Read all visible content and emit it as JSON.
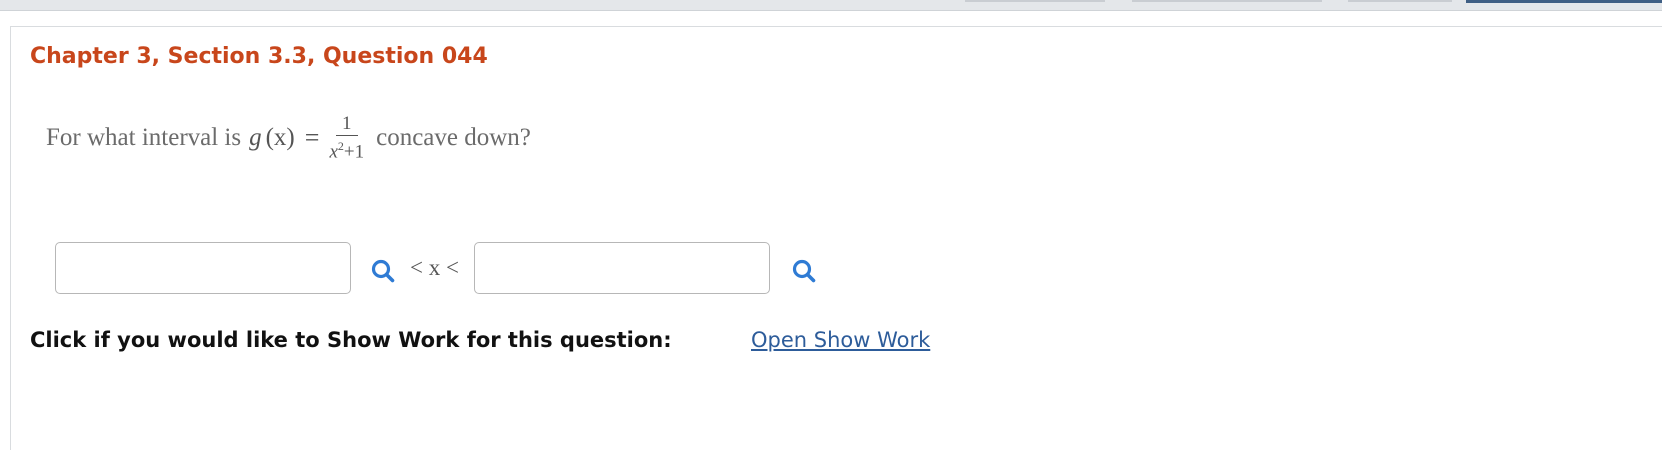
{
  "question": {
    "title": "Chapter 3, Section 3.3, Question 044",
    "prompt_prefix": "For what interval is",
    "function_name": "g",
    "function_var": "(x)",
    "equals": "=",
    "fraction_numerator": "1",
    "fraction_denominator_base": "x",
    "fraction_denominator_exp": "2",
    "fraction_denominator_rest": "+1",
    "prompt_suffix": "concave down?"
  },
  "answer": {
    "lower_value": "",
    "upper_value": "",
    "inequality_text": "< x <"
  },
  "show_work": {
    "label": "Click if you would like to Show Work for this question:",
    "link_text": "Open Show Work"
  },
  "colors": {
    "title": "#c8461b",
    "link": "#2d5c9a",
    "icon": "#2f7bd4"
  },
  "icons": {
    "lookup": "magnifier-icon"
  }
}
